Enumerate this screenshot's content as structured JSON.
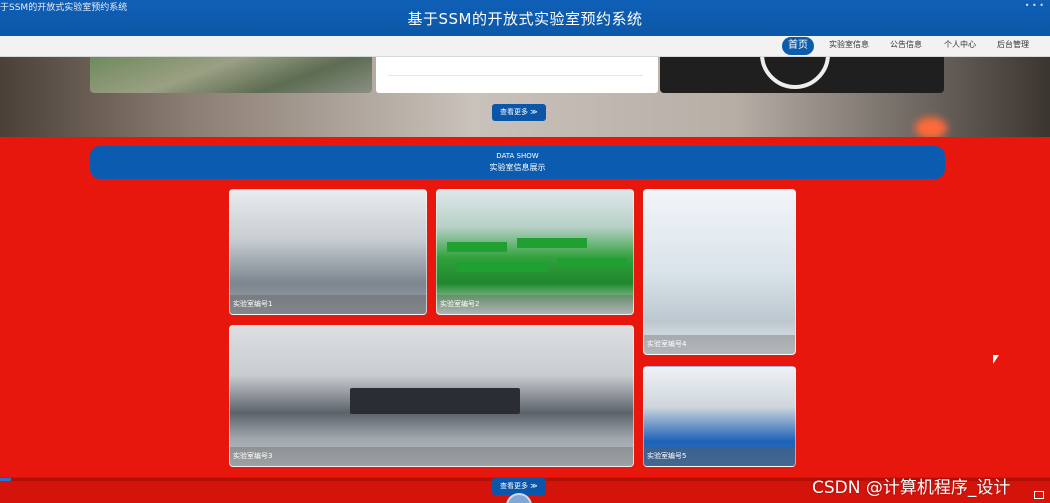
{
  "window": {
    "tab_title": "于SSM的开放式实验室预约系统",
    "controls": "• • •"
  },
  "header": {
    "title": "基于SSM的开放式实验室预约系统"
  },
  "nav": {
    "items": [
      {
        "label": "首页",
        "active": true
      },
      {
        "label": "实验室信息",
        "active": false
      },
      {
        "label": "公告信息",
        "active": false
      },
      {
        "label": "个人中心",
        "active": false
      },
      {
        "label": "后台管理",
        "active": false
      }
    ]
  },
  "hero": {
    "more_label": "查看更多 ≫"
  },
  "data_show": {
    "title_en": "DATA SHOW",
    "title_cn": "实验室信息展示",
    "items": [
      {
        "caption": "实验室编号1"
      },
      {
        "caption": "实验室编号2"
      },
      {
        "caption": "实验室编号4"
      },
      {
        "caption": "实验室编号3"
      },
      {
        "caption": "实验室编号5"
      }
    ],
    "more_label": "查看更多 ≫"
  },
  "watermark": "CSDN @计算机程序_设计",
  "video_progress": 0.01,
  "colors": {
    "page_bg": "#e8170d",
    "primary": "#0b5cb0",
    "nav_bg": "#f2f2f2"
  }
}
